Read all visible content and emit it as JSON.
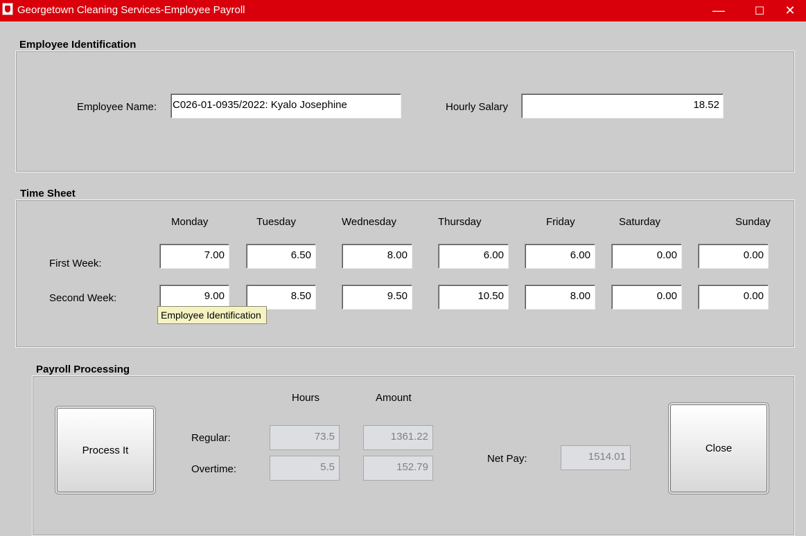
{
  "window": {
    "title": "Georgetown Cleaning Services-Employee Payroll",
    "minimize_glyph": "—",
    "maximize_glyph": "☐",
    "close_glyph": "✕",
    "accent": "#d9000c"
  },
  "employee": {
    "section_title": "Employee Identification",
    "name_label": "Employee Name:",
    "name_value": "C026-01-0935/2022: Kyalo Josephine",
    "salary_label": "Hourly Salary",
    "salary_value": "18.52"
  },
  "timesheet": {
    "section_title": "Time Sheet",
    "days": [
      "Monday",
      "Tuesday",
      "Wednesday",
      "Thursday",
      "Friday",
      "Saturday",
      "Sunday"
    ],
    "week1_label": "First Week:",
    "week2_label": "Second Week:",
    "week1": [
      "7.00",
      "6.50",
      "8.00",
      "6.00",
      "6.00",
      "0.00",
      "0.00"
    ],
    "week2": [
      "9.00",
      "8.50",
      "9.50",
      "10.50",
      "8.00",
      "0.00",
      "0.00"
    ],
    "tooltip": "Employee Identification"
  },
  "payroll": {
    "section_title": "Payroll Processing",
    "process_button": "Process It",
    "hours_header": "Hours",
    "amount_header": "Amount",
    "regular_label": "Regular:",
    "overtime_label": "Overtime:",
    "regular_hours": "73.5",
    "regular_amount": "1361.22",
    "overtime_hours": "5.5",
    "overtime_amount": "152.79",
    "net_pay_label": "Net Pay:",
    "net_pay_value": "1514.01",
    "close_button": "Close"
  }
}
